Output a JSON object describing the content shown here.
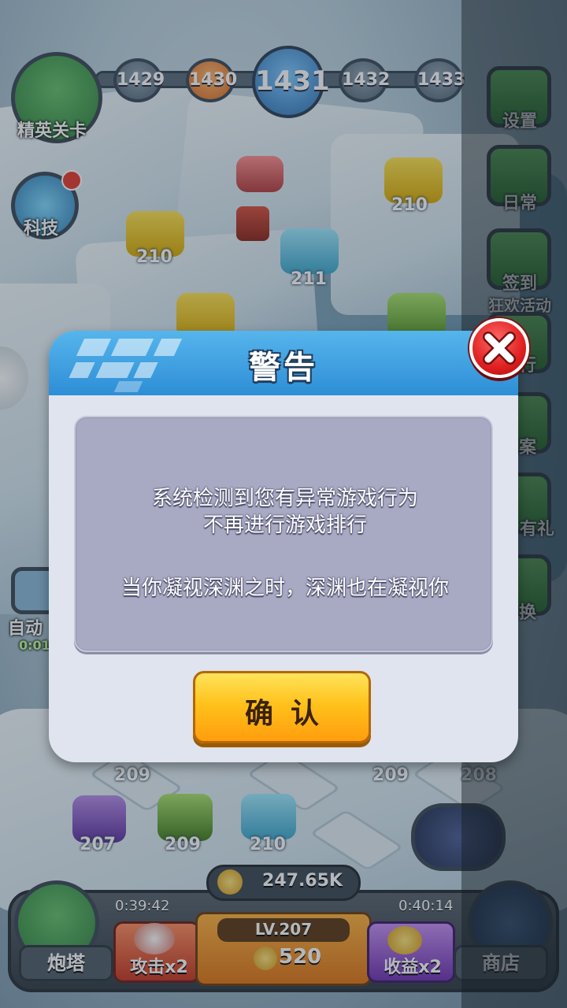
{
  "game": {
    "level_track": [
      "1429",
      "1430",
      "1431",
      "1432",
      "1433"
    ],
    "current_level": "1431",
    "left_buttons": {
      "elite_stage": "精英关卡",
      "tech": "科技",
      "auto": "自动",
      "auto_value": "0:01"
    },
    "right_menu": [
      "设置",
      "日常",
      "签到",
      "狂欢活动",
      "行",
      "案",
      "有礼",
      "换"
    ],
    "turret_levels": {
      "field": [
        "210",
        "210",
        "211"
      ],
      "bottom_row": [
        "209",
        "209",
        "208"
      ],
      "slots": [
        "207",
        "209",
        "210"
      ]
    },
    "hud": {
      "gold": "247.65K",
      "timer_left": "0:39:42",
      "timer_right": "0:40:14",
      "level": "LV.207",
      "coin_cost": "520",
      "tower": "炮塔",
      "attack": "攻击x2",
      "income": "收益x2",
      "shop": "商店"
    }
  },
  "dialog": {
    "title": "警告",
    "message_line1": "系统检测到您有异常游戏行为",
    "message_line2": "不再进行游戏排行",
    "message_line3": "当你凝视深渊之时，深渊也在凝视你",
    "confirm_label": "确认",
    "close_icon": "close-x-icon"
  },
  "colors": {
    "header_blue": "#2e8ed6",
    "panel_gray": "#a8a9c3",
    "button_yellow": "#ffc21c",
    "close_red": "#e02020"
  }
}
